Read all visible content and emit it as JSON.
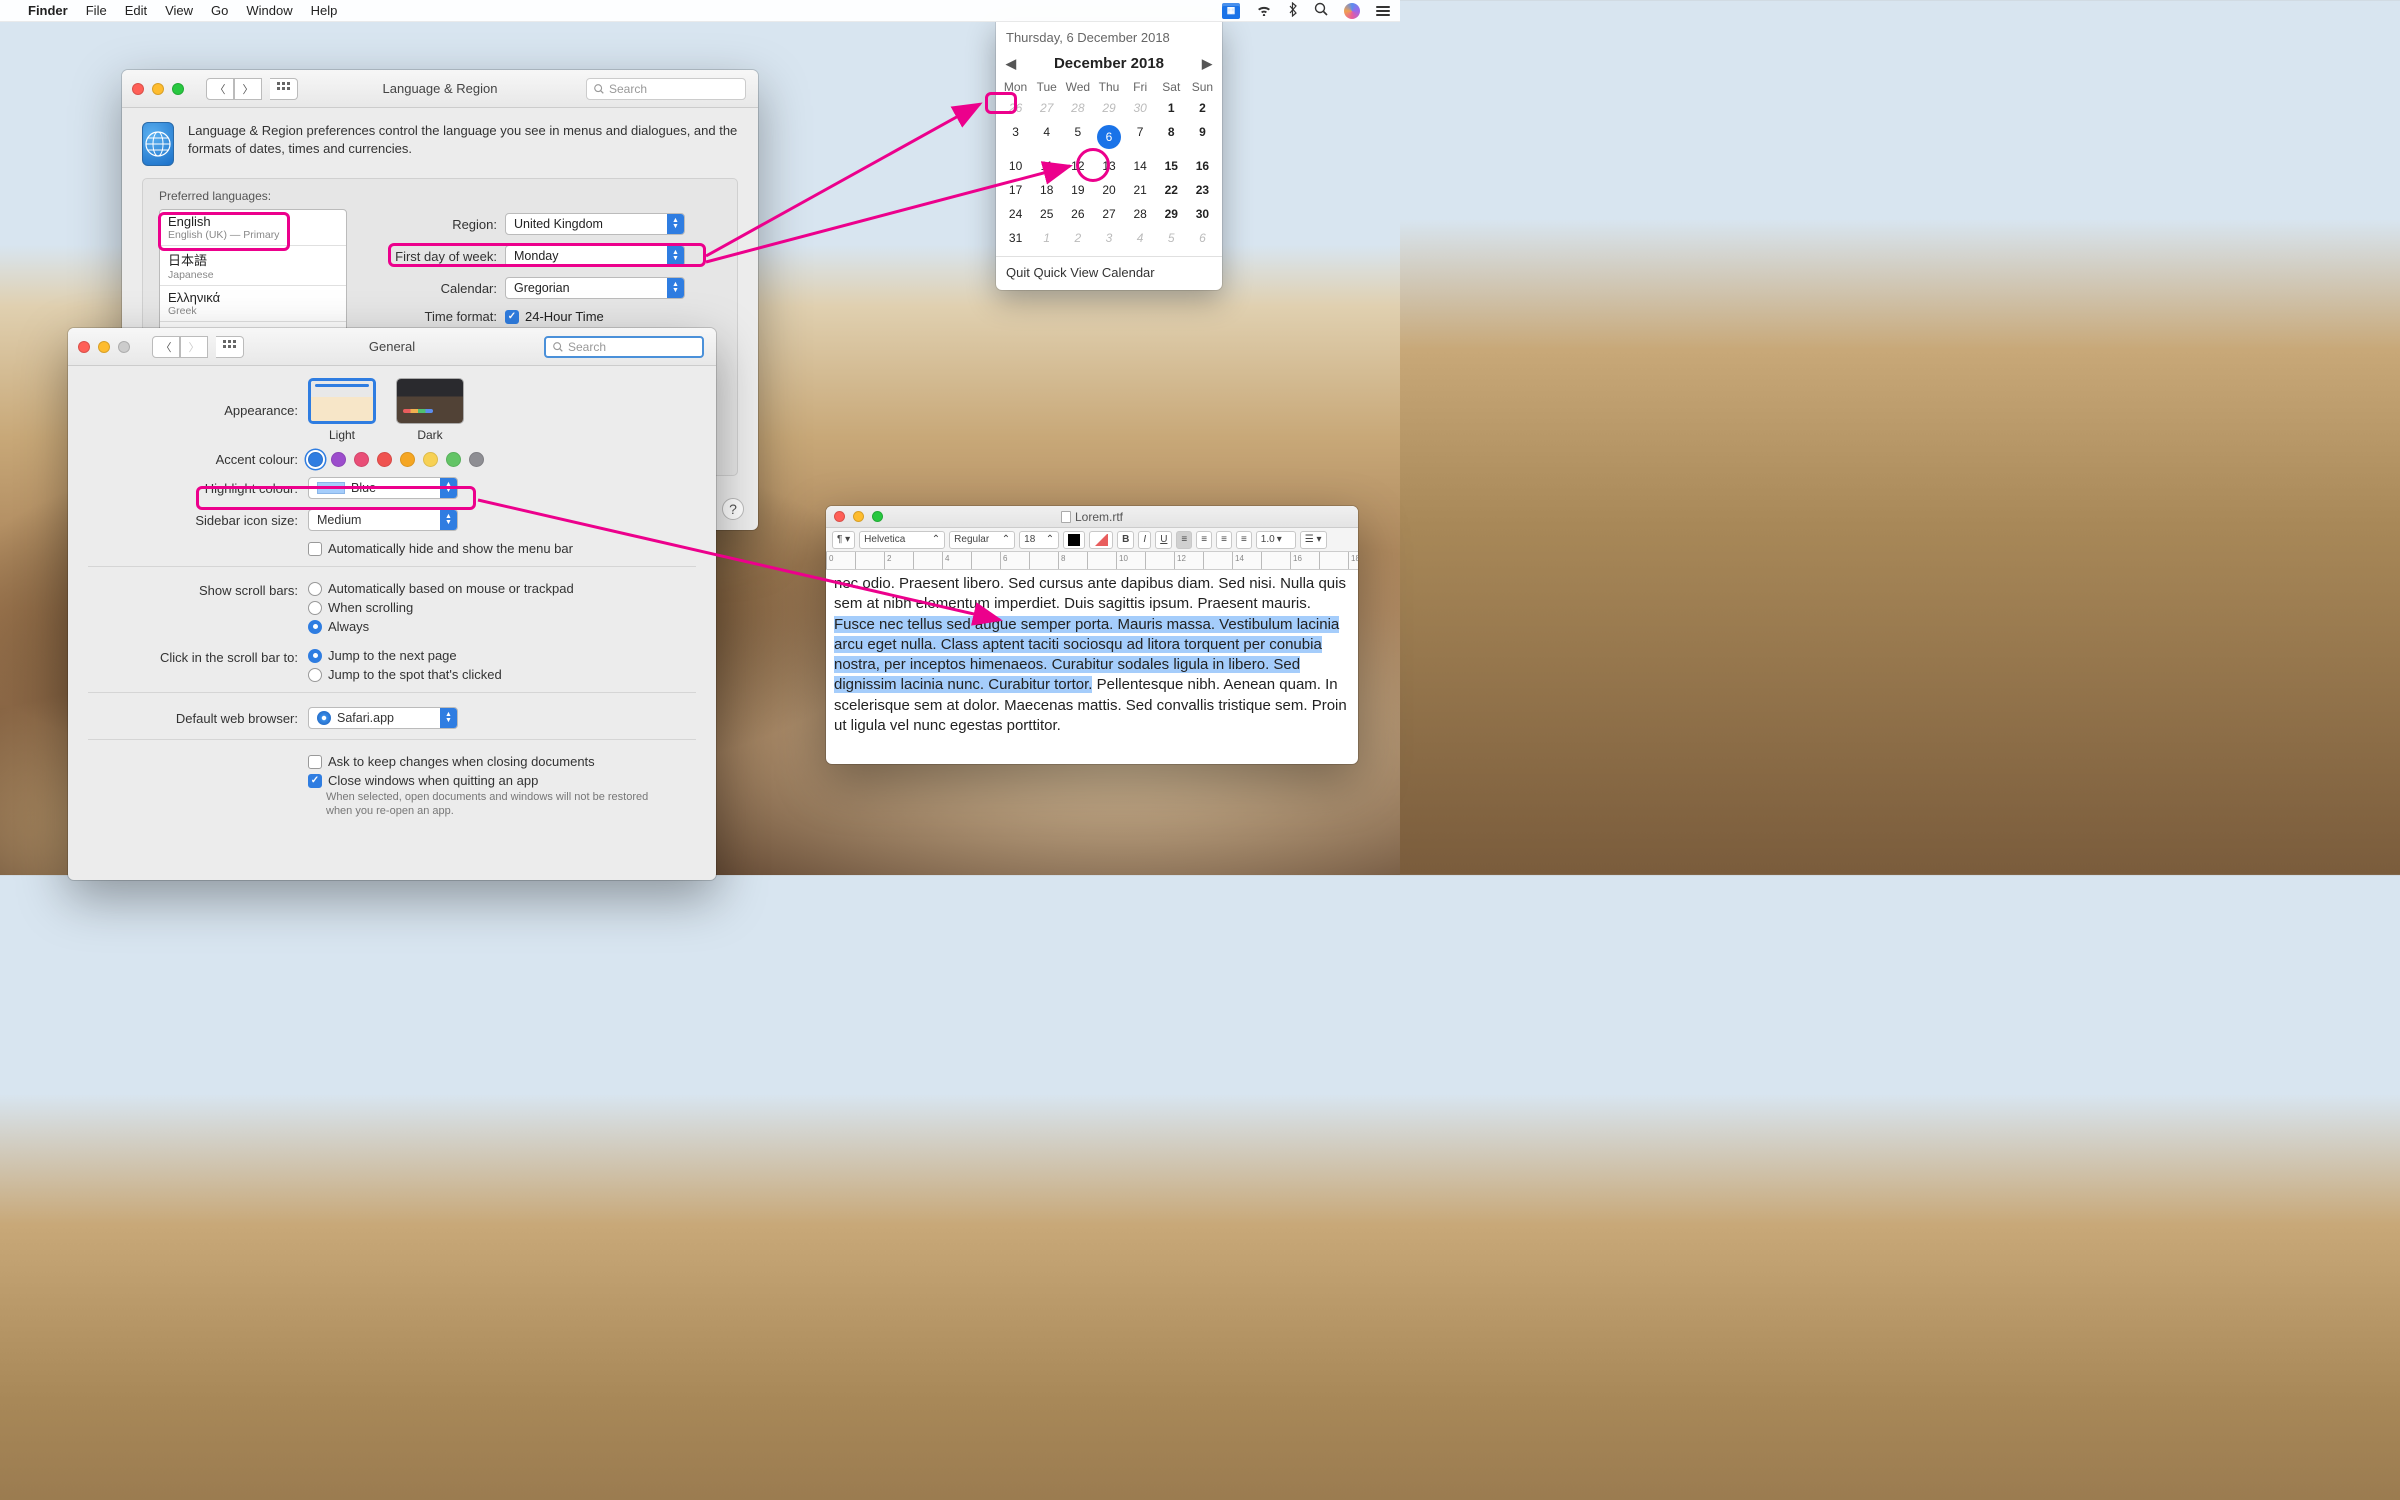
{
  "menubar": {
    "app": "Finder",
    "items": [
      "File",
      "Edit",
      "View",
      "Go",
      "Window",
      "Help"
    ]
  },
  "lang_region": {
    "title": "Language & Region",
    "search_ph": "Search",
    "intro": "Language & Region preferences control the language you see in menus and dialogues, and the formats of dates, times and currencies.",
    "pref_label": "Preferred languages:",
    "languages": [
      {
        "main": "English",
        "sub": "English (UK) — Primary"
      },
      {
        "main": "日本語",
        "sub": "Japanese"
      },
      {
        "main": "Ελληνικά",
        "sub": "Greek"
      }
    ],
    "region_label": "Region:",
    "region_value": "United Kingdom",
    "fdow_label": "First day of week:",
    "fdow_value": "Monday",
    "calendar_label": "Calendar:",
    "calendar_value": "Gregorian",
    "time_label": "Time format:",
    "time_value": "24-Hour Time"
  },
  "general": {
    "title": "General",
    "search_ph": "Search",
    "appearance_label": "Appearance:",
    "light": "Light",
    "dark": "Dark",
    "accent_label": "Accent colour:",
    "accent_colors": [
      "#2f7de1",
      "#9c4dcc",
      "#e94e77",
      "#ef5350",
      "#f5a623",
      "#f7d154",
      "#63c466",
      "#8e8e93"
    ],
    "highlight_label": "Highlight colour:",
    "highlight_value": "Blue",
    "sidebar_label": "Sidebar icon size:",
    "sidebar_value": "Medium",
    "autohide": "Automatically hide and show the menu bar",
    "scroll_label": "Show scroll bars:",
    "scroll_opts": [
      "Automatically based on mouse or trackpad",
      "When scrolling",
      "Always"
    ],
    "scroll_sel": 2,
    "click_label": "Click in the scroll bar to:",
    "click_opts": [
      "Jump to the next page",
      "Jump to the spot that's clicked"
    ],
    "click_sel": 0,
    "browser_label": "Default web browser:",
    "browser_value": "Safari.app",
    "ask_close": "Ask to keep changes when closing documents",
    "close_quit": "Close windows when quitting an app",
    "close_note": "When selected, open documents and windows will not be restored when you re-open an app."
  },
  "textedit": {
    "title": "Lorem.rtf",
    "font": "Helvetica",
    "style": "Regular",
    "size": "18",
    "spacing": "1.0",
    "pre": "nec odio. Praesent libero. Sed cursus ante dapibus diam. Sed nisi. Nulla quis sem at nibh elementum imperdiet. Duis sagittis ipsum. Praesent mauris. ",
    "hl": "Fusce nec tellus sed augue semper porta. Mauris massa. Vestibulum lacinia arcu eget nulla. Class aptent taciti sociosqu ad litora torquent per conubia nostra, per inceptos himenaeos. Curabitur sodales ligula in libero. Sed dignissim lacinia nunc. Curabitur tortor.",
    "post": " Pellentesque nibh. Aenean quam. In scelerisque sem at dolor. Maecenas mattis. Sed convallis tristique sem. Proin ut ligula vel nunc egestas porttitor."
  },
  "calendar": {
    "header": "Thursday, 6 December 2018",
    "month": "December 2018",
    "days": [
      "Mon",
      "Tue",
      "Wed",
      "Thu",
      "Fri",
      "Sat",
      "Sun"
    ],
    "grid": [
      [
        26,
        27,
        28,
        29,
        30,
        1,
        2
      ],
      [
        3,
        4,
        5,
        6,
        7,
        8,
        9
      ],
      [
        10,
        11,
        12,
        13,
        14,
        15,
        16
      ],
      [
        17,
        18,
        19,
        20,
        21,
        22,
        23
      ],
      [
        24,
        25,
        26,
        27,
        28,
        29,
        30
      ],
      [
        31,
        1,
        2,
        3,
        4,
        5,
        6
      ]
    ],
    "quit": "Quit Quick View Calendar"
  }
}
